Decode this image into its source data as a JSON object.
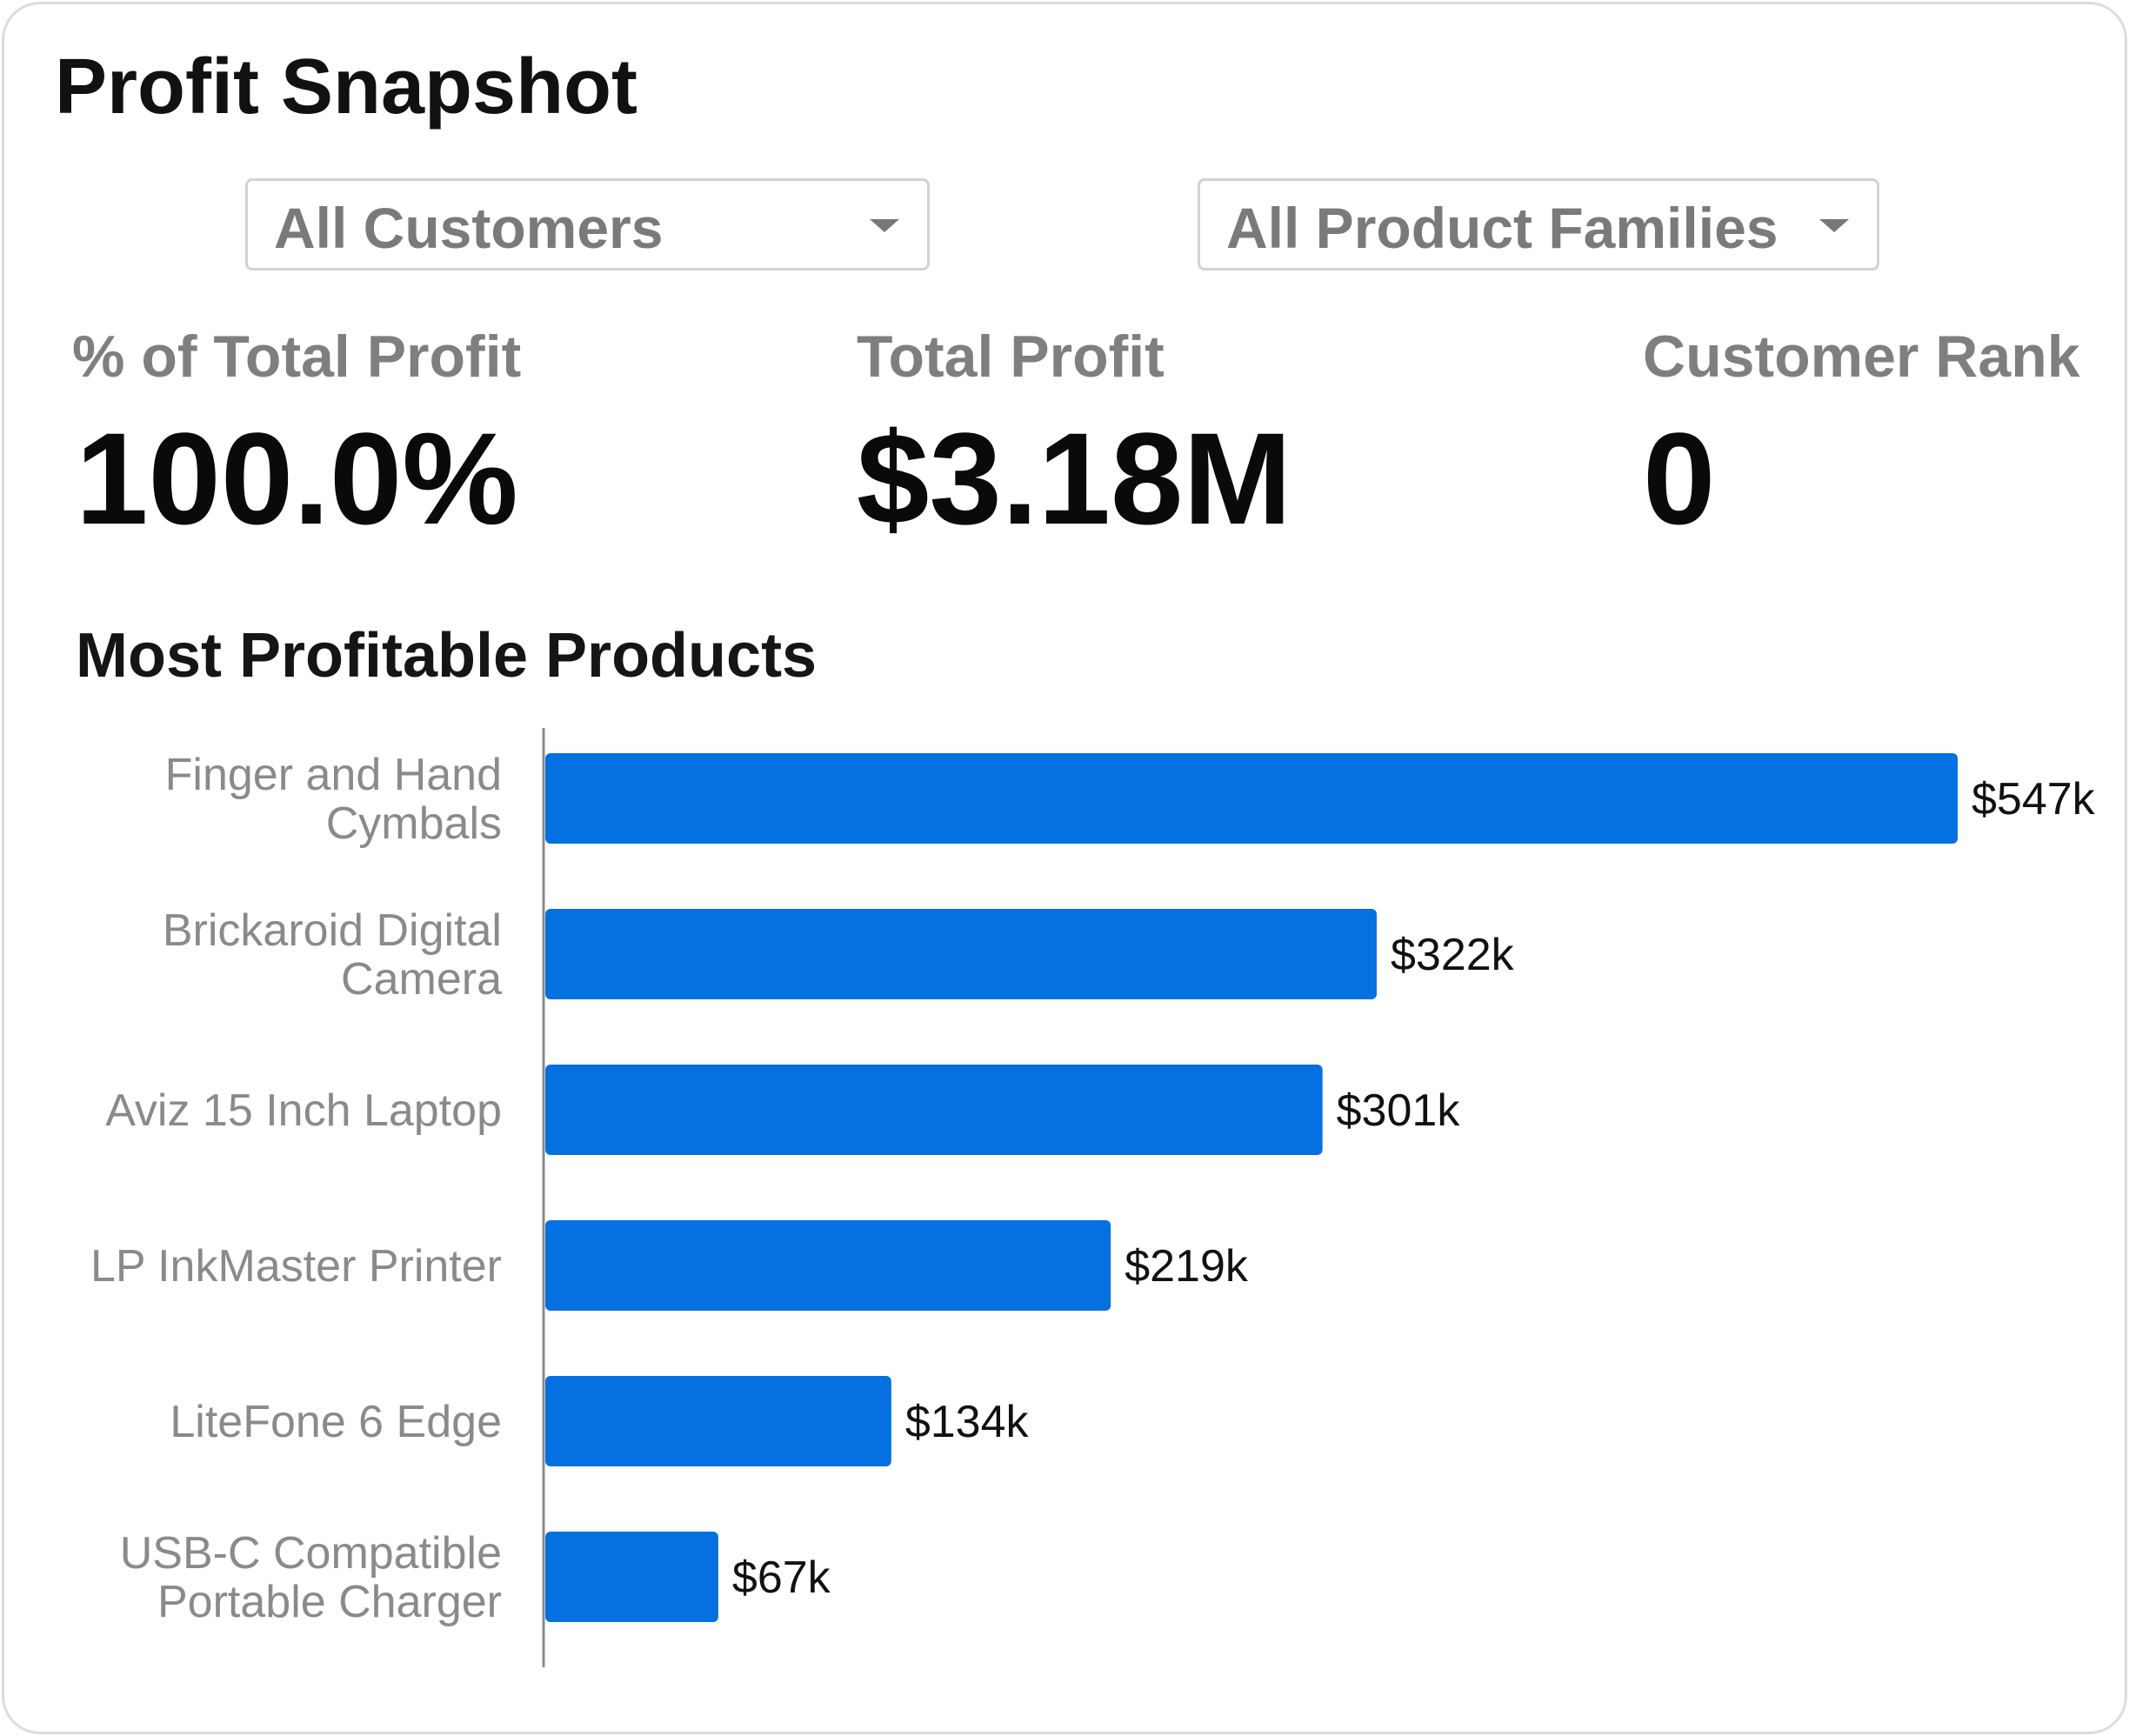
{
  "header": {
    "title": "Profit Snapshot"
  },
  "filters": {
    "customers": {
      "selected": "All Customers"
    },
    "product_families": {
      "selected": "All Product Families"
    }
  },
  "kpis": {
    "pct_total_profit": {
      "label": "% of Total Profit",
      "value": "100.0%"
    },
    "total_profit": {
      "label": "Total Profit",
      "value": "$3.18M"
    },
    "customer_rank": {
      "label": "Customer Rank",
      "value": "0"
    }
  },
  "section": {
    "title": "Most Profitable Products"
  },
  "colors": {
    "bar": "#0570e0",
    "axis": "#8a8a8a"
  },
  "chart_data": {
    "type": "bar",
    "orientation": "horizontal",
    "title": "Most Profitable Products",
    "categories": [
      [
        "Finger and Hand",
        "Cymbals"
      ],
      [
        "Brickaroid Digital",
        "Camera"
      ],
      [
        "Aviz 15 Inch Laptop"
      ],
      [
        "LP InkMaster Printer"
      ],
      [
        "LiteFone 6 Edge"
      ],
      [
        "USB-C Compatible",
        "Portable Charger"
      ]
    ],
    "values": [
      547,
      322,
      301,
      219,
      134,
      67
    ],
    "value_labels": [
      "$547k",
      "$322k",
      "$301k",
      "$219k",
      "$134k",
      "$67k"
    ],
    "unit": "$k",
    "xlim": [
      0,
      547
    ]
  }
}
